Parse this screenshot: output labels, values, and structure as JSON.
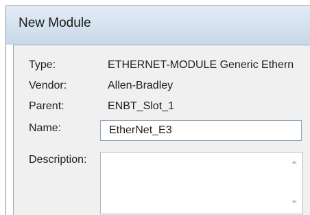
{
  "window": {
    "title": "New Module"
  },
  "fields": {
    "type": {
      "label": "Type:",
      "value": "ETHERNET-MODULE Generic Ethern"
    },
    "vendor": {
      "label": "Vendor:",
      "value": "Allen-Bradley"
    },
    "parent": {
      "label": "Parent:",
      "value": "ENBT_Slot_1"
    },
    "name": {
      "label": "Name:",
      "value": "EtherNet_E3"
    },
    "description": {
      "label": "Description:",
      "value": ""
    }
  },
  "icons": [
    "scroll-up-icon",
    "scroll-down-icon"
  ]
}
